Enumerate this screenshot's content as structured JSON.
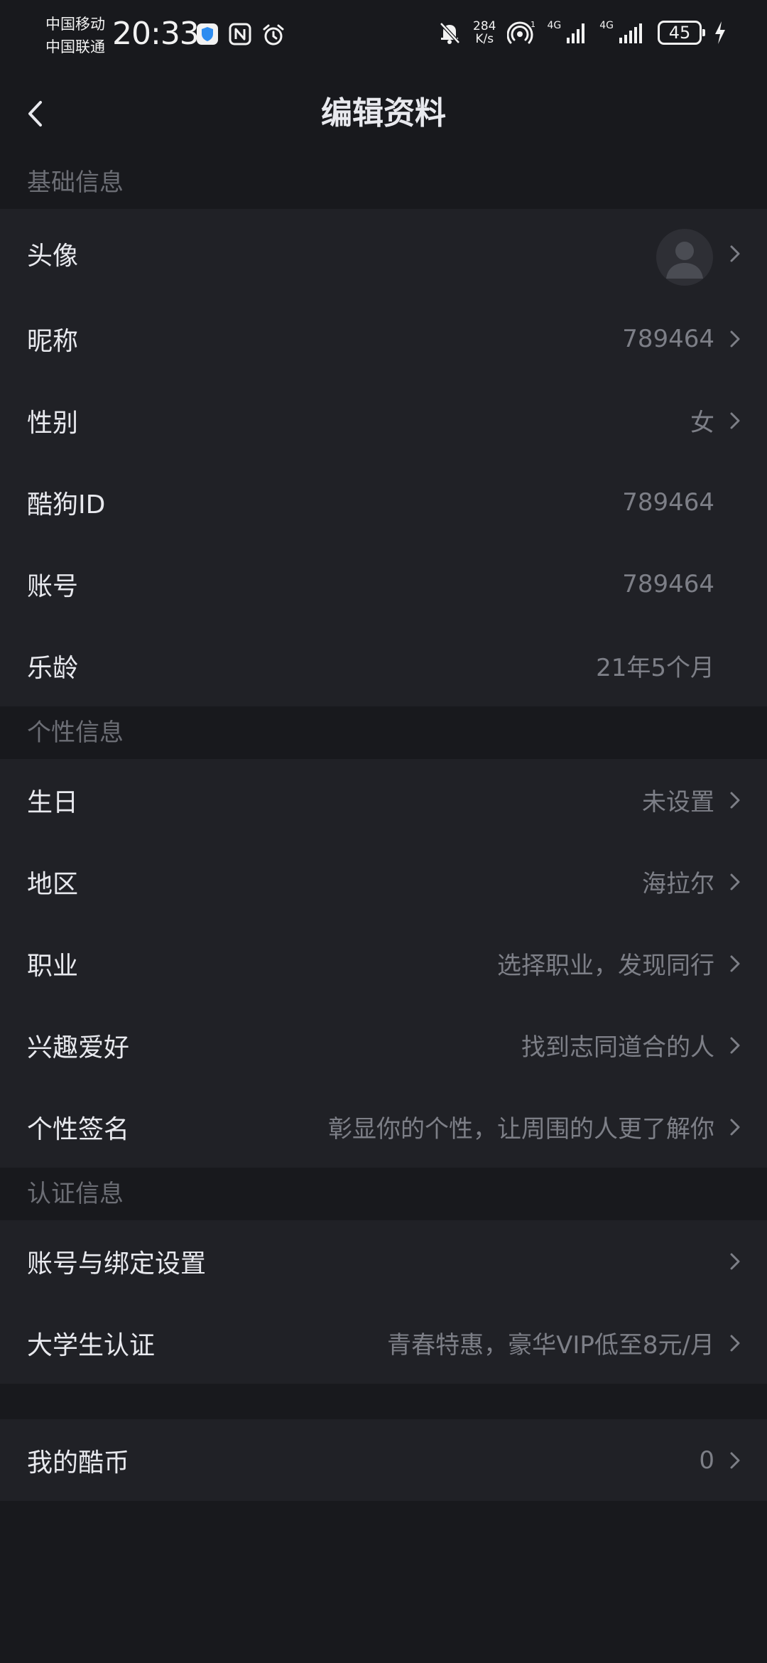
{
  "status_bar": {
    "carrier_1": "中国移动",
    "carrier_2": "中国联通",
    "time": "20:33",
    "net_speed_value": "284",
    "net_speed_unit": "K/s",
    "signal_1_label": "4G",
    "signal_2_label": "4G",
    "battery": "45",
    "icons": [
      "shield-app-icon",
      "nfc-icon",
      "alarm-icon",
      "mute-bell-icon",
      "hotspot-icon",
      "signal-icon",
      "signal-icon",
      "battery-icon",
      "charging-icon"
    ]
  },
  "header": {
    "title": "编辑资料",
    "back_icon": "chevron-left-icon"
  },
  "sections": {
    "basic": {
      "title": "基础信息",
      "avatar_label": "头像",
      "nickname_label": "昵称",
      "nickname_value": "789464",
      "gender_label": "性别",
      "gender_value": "女",
      "kugou_id_label": "酷狗ID",
      "kugou_id_value": "789464",
      "account_label": "账号",
      "account_value": "789464",
      "music_age_label": "乐龄",
      "music_age_value": "21年5个月"
    },
    "personal": {
      "title": "个性信息",
      "birthday_label": "生日",
      "birthday_value": "未设置",
      "region_label": "地区",
      "region_value": "海拉尔",
      "job_label": "职业",
      "job_value": "选择职业，发现同行",
      "hobby_label": "兴趣爱好",
      "hobby_value": "找到志同道合的人",
      "signature_label": "个性签名",
      "signature_value": "彰显你的个性，让周围的人更了解你"
    },
    "auth": {
      "title": "认证信息",
      "binding_label": "账号与绑定设置",
      "student_label": "大学生认证",
      "student_value": "青春特惠，豪华VIP低至8元/月"
    },
    "coins": {
      "label": "我的酷币",
      "value": "0"
    }
  },
  "colors": {
    "background": "#18191d",
    "card": "#202126",
    "primary_text": "#e8e9ee",
    "secondary_text": "#7d7f87",
    "section_text": "#6c6e75"
  }
}
